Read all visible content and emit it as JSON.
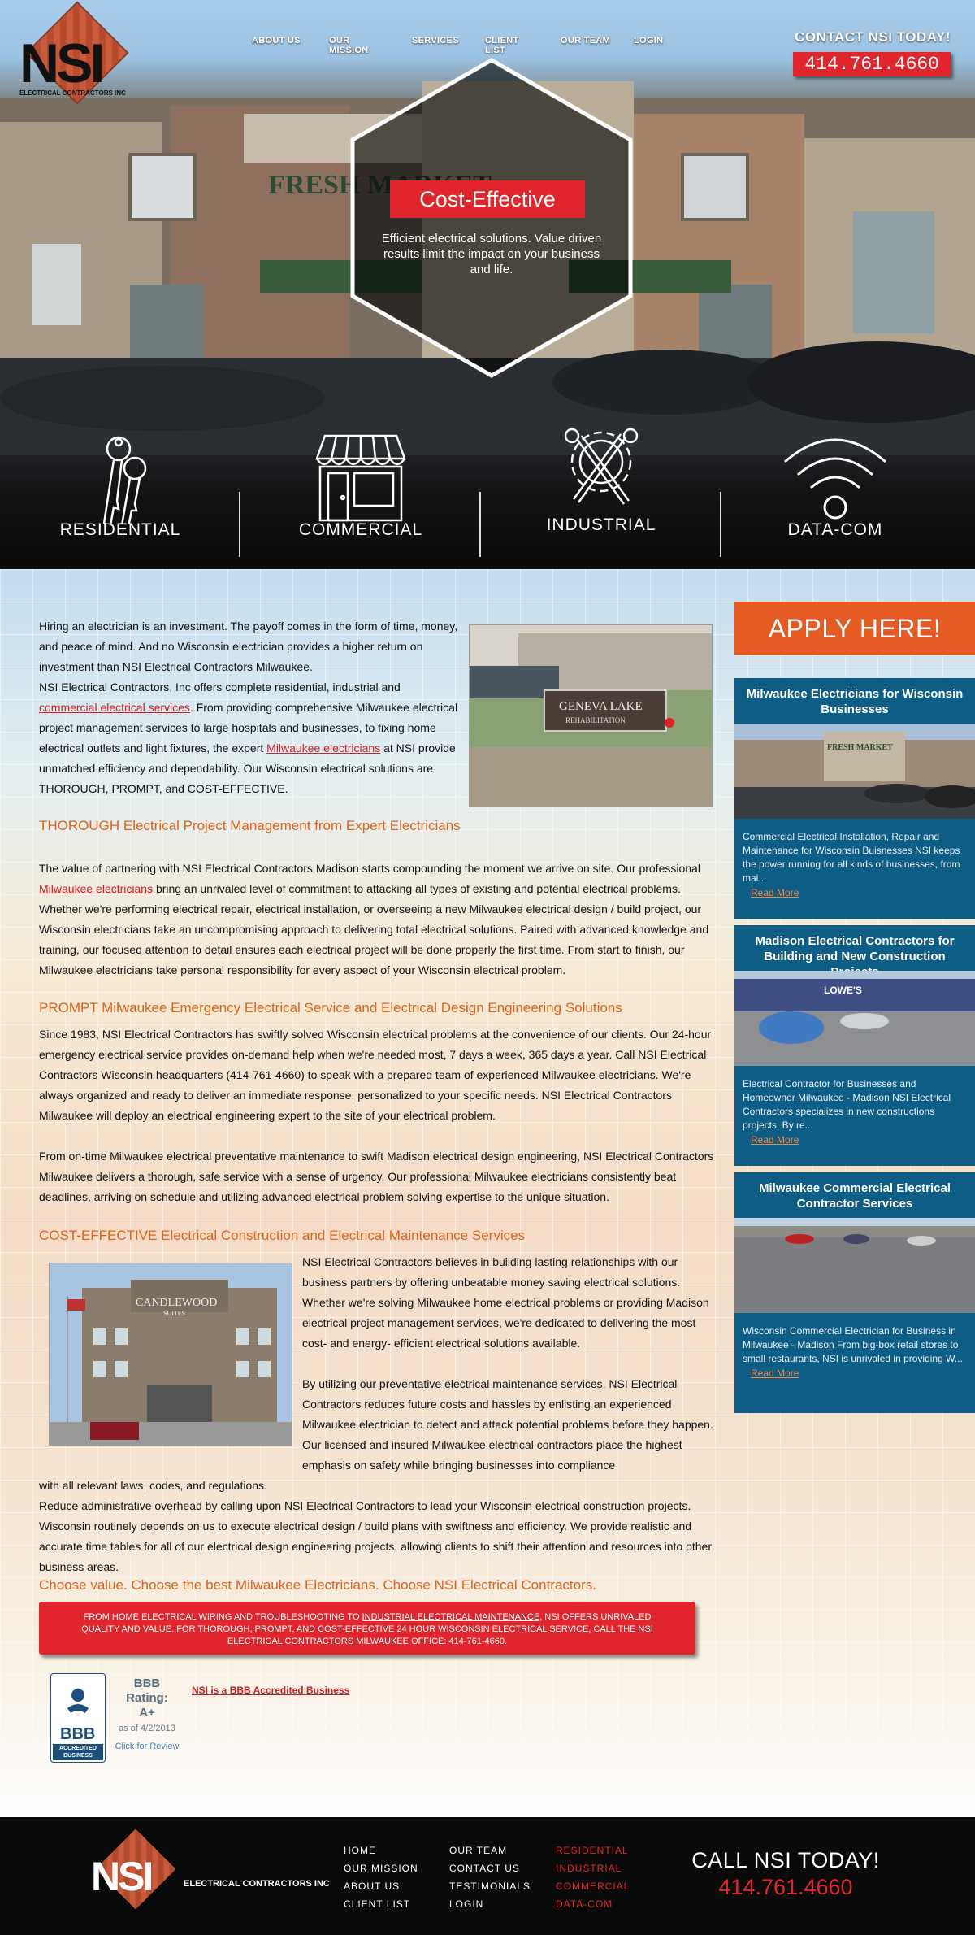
{
  "header": {
    "logo_text": "NSI",
    "logo_subtitle": "ELECTRICAL CONTRACTORS INC",
    "nav": [
      "ABOUT US",
      "OUR MISSION",
      "SERVICES",
      "CLIENT LIST",
      "OUR TEAM",
      "LOGIN"
    ],
    "contact_label": "CONTACT NSI TODAY!",
    "contact_phone": "414.761.4660"
  },
  "hero": {
    "title": "Cost-Effective",
    "text": "Efficient electrical solutions. Value driven results limit the impact on your business and life.",
    "services": [
      {
        "label": "RESIDENTIAL",
        "icon": "keys-icon"
      },
      {
        "label": "COMMERCIAL",
        "icon": "storefront-icon"
      },
      {
        "label": "INDUSTRIAL",
        "icon": "gear-tools-icon"
      },
      {
        "label": "DATA-COM",
        "icon": "wifi-icon"
      }
    ]
  },
  "content": {
    "p1": "Hiring an electrician is an investment. The payoff comes in the form of time, money, and peace of mind. And no Wisconsin electrician provides a higher return on investment than NSI Electrical Contractors Milwaukee.",
    "p2_a": "NSI Electrical Contractors, Inc offers complete residential, industrial and",
    "p2_link1": "commercial electrical services",
    "p2_b": ". From providing comprehensive Milwaukee electrical project management services to large hospitals and businesses, to fixing home electrical outlets and light fixtures, the expert",
    "p2_link2": "Milwaukee electricians",
    "p2_c": "at NSI provide unmatched efficiency and dependability. Our Wisconsin electrical solutions are THOROUGH, PROMPT, and COST-EFFECTIVE.",
    "h1": "THOROUGH Electrical Project Management from Expert Electricians",
    "p3_a": "The value of partnering with NSI Electrical Contractors Madison starts compounding the moment we arrive on site. Our professional",
    "p3_link": "Milwaukee electricians",
    "p3_b": "bring an unrivaled level of commitment to attacking all types of existing and potential electrical problems. Whether we're performing electrical repair, electrical installation, or overseeing a new Milwaukee electrical design / build project, our Wisconsin electricians take an uncompromising approach to delivering total electrical solutions. Paired with advanced knowledge and training, our focused attention to detail ensures each electrical project will be done properly the first time. From start to finish, our Milwaukee electricians take personal responsibility for every aspect of your Wisconsin electrical problem.",
    "h2": "PROMPT Milwaukee Emergency Electrical Service and Electrical Design Engineering Solutions",
    "p4": "Since 1983, NSI Electrical Contractors has swiftly solved Wisconsin electrical problems at the convenience of our clients. Our 24-hour emergency electrical service provides on-demand help when we're needed most, 7 days a week, 365 days a year. Call NSI Electrical Contractors Wisconsin headquarters (414-761-4660) to speak with a prepared team of experienced Milwaukee electricians. We're always organized and ready to deliver an immediate response, personalized to your specific needs. NSI Electrical Contractors Milwaukee will deploy an electrical engineering expert to the site of your electrical problem.",
    "p5": "From on-time Milwaukee electrical preventative maintenance to swift Madison electrical design engineering, NSI Electrical Contractors Milwaukee delivers a thorough, safe service with a sense of urgency. Our professional Milwaukee electricians consistently beat deadlines, arriving on schedule and utilizing advanced electrical problem solving expertise to the unique situation.",
    "h3": "COST-EFFECTIVE Electrical Construction and Electrical Maintenance Services",
    "p6": "NSI Electrical Contractors believes in building lasting relationships with our business partners by offering unbeatable money saving electrical solutions. Whether we're solving Milwaukee home electrical problems or providing Madison electrical project management services, we're dedicated to delivering the most cost- and energy- efficient electrical solutions available.",
    "p7_a": "By utilizing our preventative electrical maintenance services, NSI Electrical Contractors reduces future costs and hassles by enlisting an experienced Milwaukee electrician to detect and attack potential problems before they happen. Our licensed and insured Milwaukee electrical contractors place the highest emphasis on safety while bringing businesses into compliance",
    "p7_b": "with all relevant laws, codes, and regulations.",
    "p8": "Reduce administrative overhead by calling upon NSI Electrical Contractors to lead your Wisconsin electrical construction projects.  Wisconsin routinely depends on us to execute electrical design / build plans with swiftness and efficiency. We provide realistic and accurate time tables for all of our electrical design engineering projects, allowing clients to shift their attention and resources into other business areas.",
    "h4": "Choose value. Choose the best Milwaukee Electricians. Choose NSI Electrical Contractors.",
    "photo1_sign": "GENEVA LAKE",
    "photo1_sign2": "REHABILITATION",
    "photo2_sign": "CANDLEWOOD",
    "photo2_sign2": "SUITES"
  },
  "cta": {
    "a": "FROM HOME ELECTRICAL WIRING AND TROUBLESHOOTING TO",
    "link": "INDUSTRIAL ELECTRICAL MAINTENANCE",
    "b": ", NSI OFFERS UNRIVALED QUALITY AND VALUE. FOR THOROUGH, PROMPT, AND COST-EFFECTIVE 24 HOUR WISCONSIN ELECTRICAL SERVICE, CALL THE NSI ELECTRICAL CONTRACTORS MILWAUKEE OFFICE: 414-761-4660."
  },
  "bbb": {
    "rating_line1": "BBB",
    "rating_line2": "Rating:",
    "rating_line3": "A+",
    "as_of": "as of 4/2/2013",
    "review": "Click for Review",
    "seal_text1": "ACCREDITED",
    "seal_text2": "BUSINESS",
    "seal_logo": "BBB",
    "link": "NSI is a BBB Accredited Business"
  },
  "sidebar": {
    "apply": "APPLY HERE!",
    "cards": [
      {
        "title": "Milwaukee Electricians for Wisconsin Businesses",
        "desc": "Commercial Electrical Installation, Repair and Maintenance for Wisconsin Buisnesses NSI keeps the power running for all kinds of businesses, from mai...",
        "more": "Read More",
        "img_sign": "FRESH MARKET"
      },
      {
        "title": "Madison Electrical Contractors for Building and New Construction Projects",
        "desc": "Electrical Contractor for Businesses and Homeowner Milwaukee - Madison NSI Electrical Contractors specializes in new constructions projects. By re...",
        "more": "Read More",
        "img_sign": "LOWE'S"
      },
      {
        "title": "Milwaukee Commercial Electrical Contractor Services",
        "desc": "Wisconsin Commercial Electrician for Business in Milwaukee - Madison From big-box retail stores to small restaurants, NSI is unrivaled in providing W...",
        "more": "Read More"
      }
    ]
  },
  "footer": {
    "logo_text": "NSI",
    "logo_subtitle": "ELECTRICAL CONTRACTORS INC",
    "col1": [
      "HOME",
      "OUR MISSION",
      "ABOUT US",
      "CLIENT LIST"
    ],
    "col2": [
      "OUR TEAM",
      "CONTACT US",
      "TESTIMONIALS",
      "LOGIN"
    ],
    "col3": [
      "RESIDENTIAL",
      "INDUSTRIAL",
      "COMMERCIAL",
      "DATA-COM"
    ],
    "call_label": "CALL NSI TODAY!",
    "call_phone": "414.761.4660"
  },
  "hero_sign": "FRESH MARKET",
  "colors": {
    "accent_red": "#e0262c",
    "accent_orange": "#e55b22",
    "card_blue": "#0e5d86"
  }
}
